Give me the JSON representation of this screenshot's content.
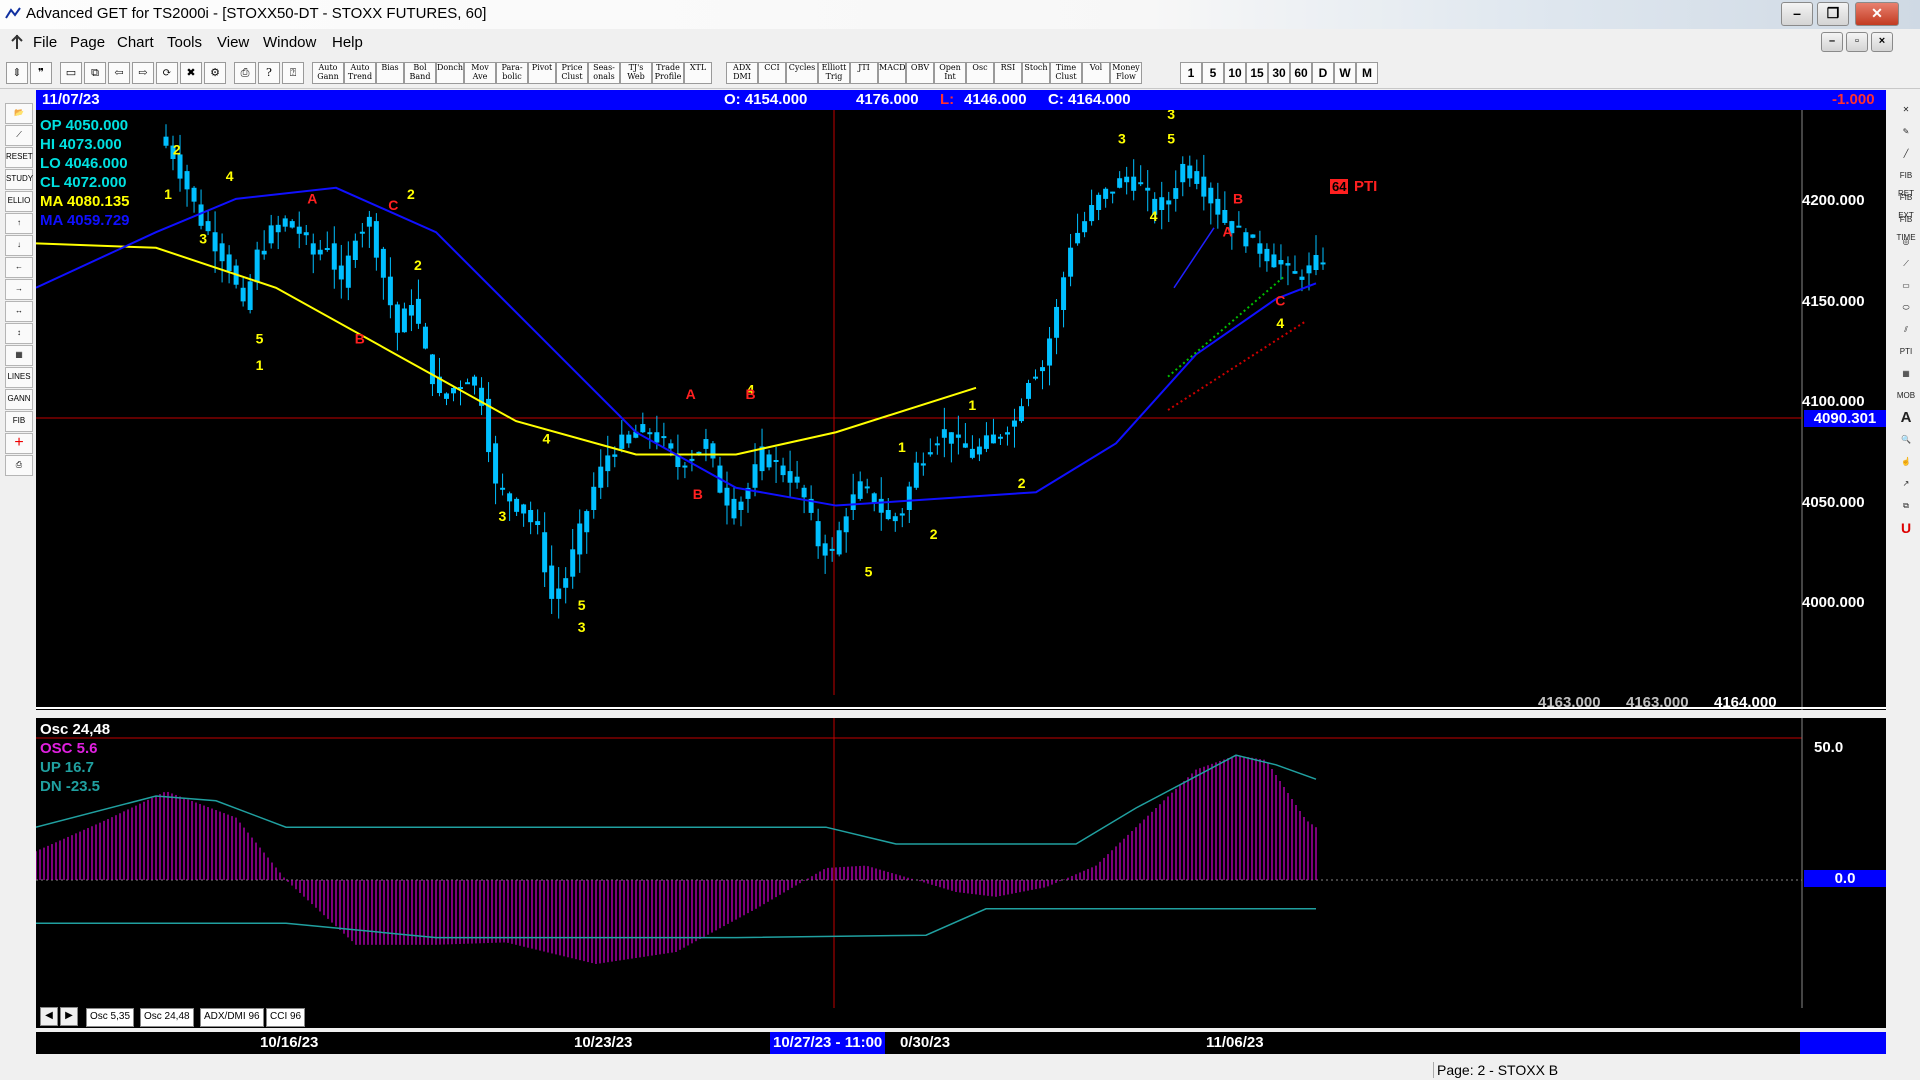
{
  "window": {
    "title": "Advanced GET for TS2000i - [STOXX50-DT - STOXX FUTURES, 60]"
  },
  "menu": [
    "File",
    "Page",
    "Chart",
    "Tools",
    "View",
    "Window",
    "Help"
  ],
  "toolbar": {
    "indicators": [
      "Auto Gann",
      "Auto Trend",
      "Bias",
      "Bol Band",
      "Donch",
      "Mov Ave",
      "Para-bolic",
      "Pivot",
      "Price Clust",
      "Seas-onals",
      "TJ's Web",
      "Trade Profile",
      "XTL",
      "ADX DMI",
      "CCI",
      "Cycles",
      "Elliott Trig",
      "JTI",
      "MACD",
      "OBV",
      "Open Int",
      "Osc",
      "RSI",
      "Stoch",
      "Time Clust",
      "Vol",
      "Money Flow"
    ],
    "timeframes": [
      "1",
      "5",
      "10",
      "15",
      "30",
      "60",
      "D",
      "W",
      "M"
    ]
  },
  "left_tools": [
    "open-icon",
    "trend-icon",
    "reset",
    "study",
    "elliott",
    "up-arrow-icon",
    "down-arrow-icon",
    "left-arrow-icon",
    "right-arrow-icon",
    "zoom-h-icon",
    "zoom-v-icon",
    "grid-icon",
    "lines",
    "gann",
    "fib",
    "cross-icon",
    "print-icon"
  ],
  "right_tools": [
    "x-icon",
    "pencil-icon",
    "line-icon",
    "fib ret",
    "fib ext",
    "fib time",
    "circle-icon",
    "fan-icon",
    "rect-icon",
    "ellipse-icon",
    "channel-icon",
    "PTI",
    "grid-icon",
    "mob",
    "text-A",
    "zoom-icon",
    "hand-icon",
    "arrow-icon",
    "copy-icon",
    "magnet-U"
  ],
  "info_bar": {
    "date": "11/07/23",
    "open": "O: 4154.000",
    "high": "4176.000",
    "low_label": "L:",
    "low": "4146.000",
    "close": "C: 4164.000",
    "change": "-1.000"
  },
  "readout": {
    "op": "OP  4050.000",
    "hi": "HI   4073.000",
    "lo": "LO  4046.000",
    "cl": "CL  4072.000",
    "ma1": "MA  4080.135",
    "ma2": "MA  4059.729"
  },
  "price_axis": {
    "labels": [
      "4200.000",
      "4150.000",
      "4100.000",
      "4050.000",
      "4000.000"
    ],
    "current": "4090.301"
  },
  "bottom_values": [
    "4163.000",
    "4163.000",
    "4164.000"
  ],
  "pti": {
    "value": "64",
    "label": "PTI"
  },
  "osc_panel": {
    "title": "Osc 24,48",
    "osc": "OSC 5.6",
    "up": "UP   16.7",
    "dn": "DN   -23.5",
    "axis_top": "50.0",
    "axis_zero": "0.0"
  },
  "chart_tabs": [
    "Osc 5,35",
    "Osc 24,48",
    "ADX/DMI 96",
    "CCI 96"
  ],
  "date_axis": {
    "labels": [
      "10/16/23",
      "10/23/23",
      "0/30/23",
      "11/06/23"
    ],
    "cursor": "10/27/23 - 11:00"
  },
  "status": {
    "page": "Page: 2 - STOXX B"
  },
  "colors": {
    "background": "#000000",
    "info_bar": "#0000ff",
    "ma_slow": "#ffff00",
    "ma_fast": "#0000ff",
    "candles": "#00bfff",
    "osc": "#c000c0",
    "wave_labels": "#ffff00",
    "abc_labels": "#ff2020"
  },
  "chart_data": {
    "type": "candlestick",
    "symbol": "STOXX50-DT",
    "interval": "60",
    "ylim": [
      3960,
      4230
    ],
    "x_dates": [
      "10/16/23",
      "10/23/23",
      "10/30/23",
      "11/06/23"
    ],
    "close_path": [
      4210,
      4195,
      4180,
      4170,
      4160,
      4140,
      4165,
      4175,
      4180,
      4175,
      4165,
      4170,
      4150,
      4175,
      4180,
      4155,
      4130,
      4145,
      4120,
      4100,
      4105,
      4110,
      4100,
      4060,
      4055,
      4050,
      4040,
      4010,
      4020,
      4040,
      4060,
      4075,
      4080,
      4085,
      4085,
      4080,
      4070,
      4075,
      4080,
      4060,
      4050,
      4060,
      4075,
      4070,
      4065,
      4055,
      4035,
      4030,
      4050,
      4060,
      4055,
      4045,
      4050,
      4070,
      4080,
      4085,
      4080,
      4075,
      4080,
      4085,
      4090,
      4110,
      4115,
      4140,
      4170,
      4180,
      4190,
      4195,
      4200,
      4195,
      4185,
      4190,
      4205,
      4200,
      4190,
      4180,
      4175,
      4170,
      4165,
      4160,
      4155,
      4158,
      4164
    ],
    "elliott_labels": [
      {
        "t": "2",
        "x": 0.08,
        "y": 4210
      },
      {
        "t": "1",
        "x": 0.075,
        "y": 4190
      },
      {
        "t": "4",
        "x": 0.11,
        "y": 4198
      },
      {
        "t": "3",
        "x": 0.095,
        "y": 4170
      },
      {
        "t": "5",
        "x": 0.127,
        "y": 4125
      },
      {
        "t": "1",
        "x": 0.127,
        "y": 4113
      },
      {
        "t": "2",
        "x": 0.213,
        "y": 4190
      },
      {
        "t": "2",
        "x": 0.217,
        "y": 4158
      },
      {
        "t": "4",
        "x": 0.29,
        "y": 4080
      },
      {
        "t": "3",
        "x": 0.265,
        "y": 4045
      },
      {
        "t": "5",
        "x": 0.31,
        "y": 4005
      },
      {
        "t": "3",
        "x": 0.31,
        "y": 3995
      },
      {
        "t": "4",
        "x": 0.406,
        "y": 4102
      },
      {
        "t": "1",
        "x": 0.492,
        "y": 4076
      },
      {
        "t": "2",
        "x": 0.51,
        "y": 4037
      },
      {
        "t": "5",
        "x": 0.473,
        "y": 4020
      },
      {
        "t": "1",
        "x": 0.532,
        "y": 4095
      },
      {
        "t": "2",
        "x": 0.56,
        "y": 4060
      },
      {
        "t": "3",
        "x": 0.617,
        "y": 4215
      },
      {
        "t": "3",
        "x": 0.645,
        "y": 4226
      },
      {
        "t": "5",
        "x": 0.645,
        "y": 4215
      },
      {
        "t": "4",
        "x": 0.635,
        "y": 4180
      },
      {
        "t": "4",
        "x": 0.707,
        "y": 4132
      }
    ],
    "abc_labels": [
      {
        "t": "A",
        "x": 0.157,
        "y": 4188
      },
      {
        "t": "C",
        "x": 0.203,
        "y": 4185
      },
      {
        "t": "B",
        "x": 0.184,
        "y": 4125
      },
      {
        "t": "A",
        "x": 0.372,
        "y": 4100
      },
      {
        "t": "B",
        "x": 0.376,
        "y": 4055
      },
      {
        "t": "B",
        "x": 0.406,
        "y": 4100
      },
      {
        "t": "B",
        "x": 0.683,
        "y": 4188
      },
      {
        "t": "A",
        "x": 0.677,
        "y": 4173
      },
      {
        "t": "C",
        "x": 0.707,
        "y": 4142
      }
    ]
  }
}
